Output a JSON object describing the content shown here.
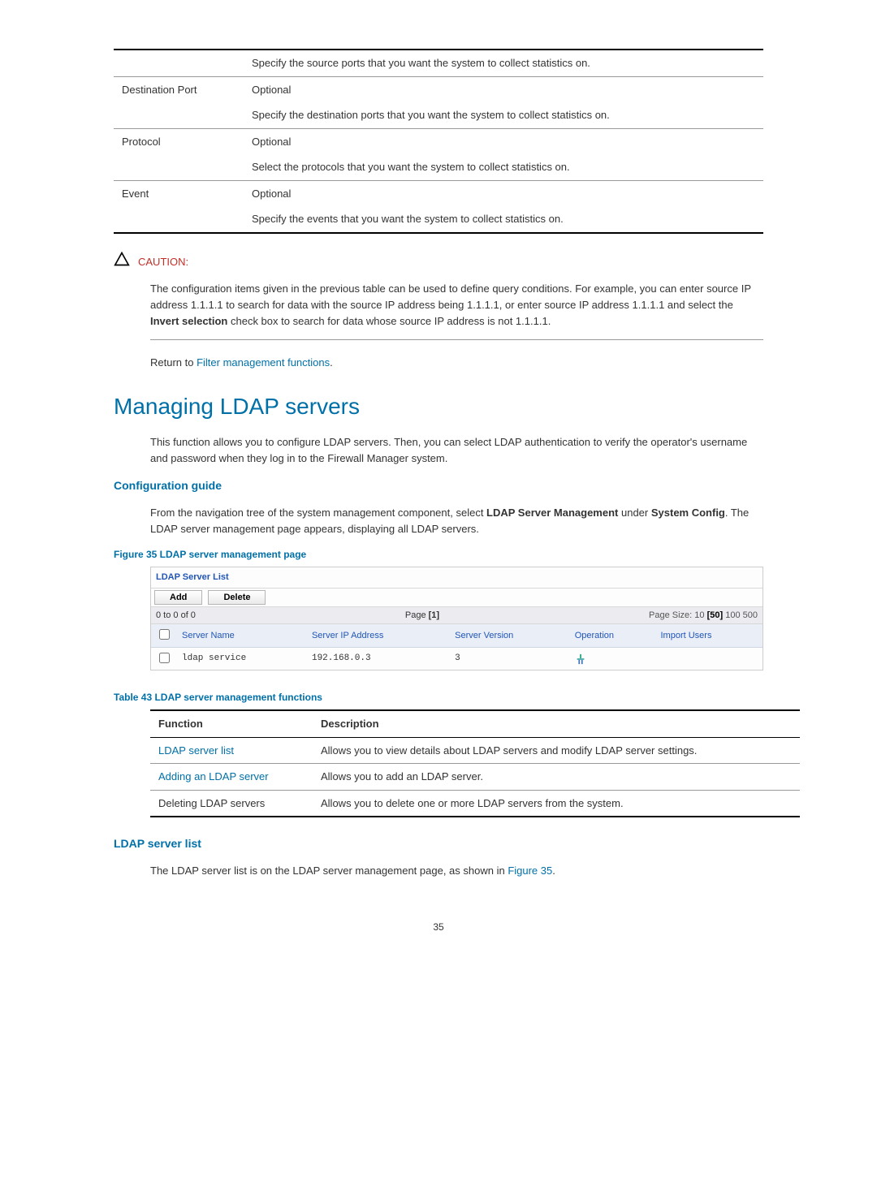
{
  "spec_table": {
    "row0_desc": "Specify the source ports that you want the system to collect statistics on.",
    "rows": [
      {
        "label": "Destination Port",
        "l1": "Optional",
        "l2": "Specify the destination ports that you want the system to collect statistics on."
      },
      {
        "label": "Protocol",
        "l1": "Optional",
        "l2": "Select the protocols that you want the system to collect statistics on."
      },
      {
        "label": "Event",
        "l1": "Optional",
        "l2": "Specify the events that you want the system to collect statistics on."
      }
    ]
  },
  "caution": {
    "label": "CAUTION:",
    "text_before_bold": "The configuration items given in the previous table can be used to define query conditions. For example, you can enter source IP address 1.1.1.1 to search for data with the source IP address being 1.1.1.1, or enter source IP address 1.1.1.1 and select the ",
    "bold": "Invert selection",
    "text_after_bold": " check box to search for data whose source IP address is not 1.1.1.1."
  },
  "return_prefix": "Return to ",
  "return_link": "Filter management functions",
  "return_suffix": ".",
  "h1": "Managing LDAP servers",
  "intro": "This function allows you to configure LDAP servers. Then, you can select LDAP authentication to verify the operator's username and password when they log in to the Firewall Manager system.",
  "config_guide": {
    "heading": "Configuration guide",
    "p_before_b1": "From the navigation tree of the system management component, select ",
    "b1": "LDAP Server Management",
    "p_mid": " under ",
    "b2": "System Config",
    "p_after_b2": ". The LDAP server management page appears, displaying all LDAP servers."
  },
  "figure35_caption": "Figure 35 LDAP server management page",
  "ldap": {
    "title": "LDAP Server List",
    "add": "Add",
    "delete": "Delete",
    "pager_left": "0 to 0 of 0",
    "pager_mid_prefix": "Page ",
    "pager_mid_num": "[1]",
    "pager_right_prefix": "Page Size: ",
    "p10": "10",
    "p50": "[50]",
    "p100": "100",
    "p500": "500",
    "cols": {
      "name": "Server Name",
      "ip": "Server IP Address",
      "ver": "Server Version",
      "op": "Operation",
      "imp": "Import Users"
    },
    "row": {
      "name": "ldap service",
      "ip": "192.168.0.3",
      "ver": "3"
    }
  },
  "table43_caption": "Table 43 LDAP server management functions",
  "table43": {
    "h_func": "Function",
    "h_desc": "Description",
    "rows": [
      {
        "f": "LDAP server list",
        "d": "Allows you to view details about LDAP servers and modify LDAP server settings.",
        "link": true
      },
      {
        "f": "Adding an LDAP server",
        "d": "Allows you to add an LDAP server.",
        "link": true
      },
      {
        "f": "Deleting LDAP servers",
        "d": "Allows you to delete one or more LDAP servers from the system.",
        "link": false
      }
    ]
  },
  "ldap_list_section": {
    "heading": "LDAP server list",
    "text_before_link": "The LDAP server list is on the LDAP server management page, as shown in ",
    "link": "Figure 35",
    "text_after_link": "."
  },
  "page_number": "35"
}
